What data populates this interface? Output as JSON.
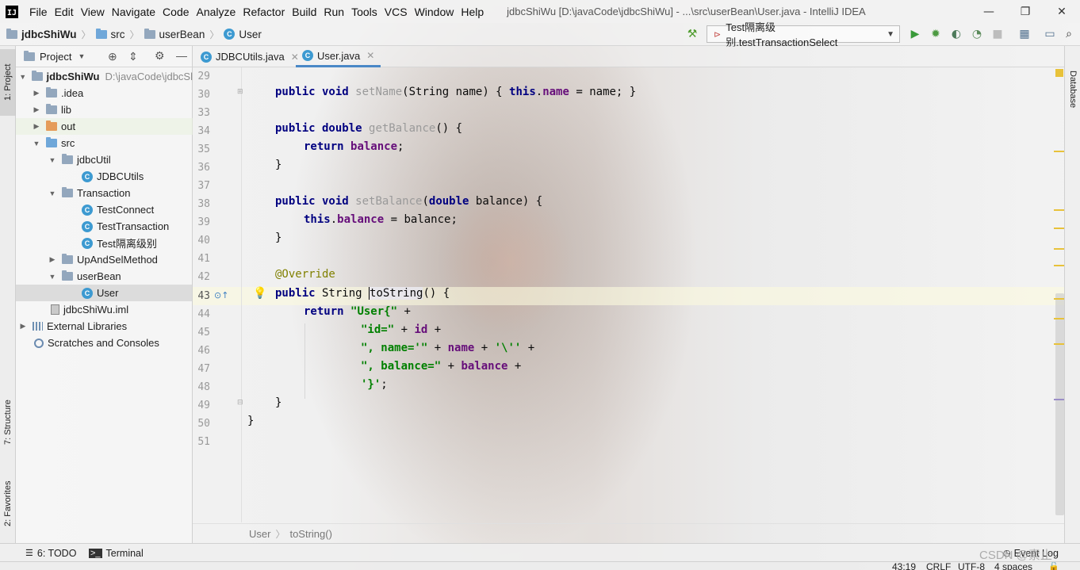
{
  "titlebar": {
    "menu": [
      "File",
      "Edit",
      "View",
      "Navigate",
      "Code",
      "Analyze",
      "Refactor",
      "Build",
      "Run",
      "Tools",
      "VCS",
      "Window",
      "Help"
    ],
    "window_title": "jdbcShiWu [D:\\javaCode\\jdbcShiWu] - ...\\src\\userBean\\User.java - IntelliJ IDEA",
    "minimize": "—",
    "restore": "❐",
    "close": "✕"
  },
  "navbar": {
    "crumbs": [
      "jdbcShiWu",
      "src",
      "userBean",
      "User"
    ],
    "run_config": "Test隔离级别.testTransactionSelect"
  },
  "left_strip": {
    "project_tab": "1: Project",
    "structure_tab": "7: Structure",
    "favorites_tab": "2: Favorites"
  },
  "right_strip": {
    "database_tab": "Database"
  },
  "project_panel": {
    "title": "Project",
    "tree": [
      {
        "label": "jdbcShiWu",
        "extra": "D:\\javaCode\\jdbcSl"
      },
      {
        "label": ".idea"
      },
      {
        "label": "lib"
      },
      {
        "label": "out"
      },
      {
        "label": "src"
      },
      {
        "label": "jdbcUtil"
      },
      {
        "label": "JDBCUtils"
      },
      {
        "label": "Transaction"
      },
      {
        "label": "TestConnect"
      },
      {
        "label": "TestTransaction"
      },
      {
        "label": "Test隔离级别"
      },
      {
        "label": "UpAndSelMethod"
      },
      {
        "label": "userBean"
      },
      {
        "label": "User"
      },
      {
        "label": "jdbcShiWu.iml"
      },
      {
        "label": "External Libraries"
      },
      {
        "label": "Scratches and Consoles"
      }
    ]
  },
  "editor": {
    "tabs": [
      "JDBCUtils.java",
      "User.java"
    ],
    "line_numbers": [
      "29",
      "30",
      "33",
      "34",
      "35",
      "36",
      "37",
      "38",
      "39",
      "40",
      "41",
      "42",
      "43",
      "44",
      "45",
      "46",
      "47",
      "48",
      "49",
      "50",
      "51"
    ],
    "code": {
      "l30_kw": "public void",
      "l30_name": "setName",
      "l30_params": "(String name) {",
      "l30_this": "this",
      "l30_field": "name",
      "l30_rest": " = name; }",
      "l34_kw": "public double",
      "l34_name": "getBalance",
      "l34_rest": "() {",
      "l35_kw": "return",
      "l35_field": "balance",
      "l35_rest": ";",
      "l36": "}",
      "l38_kw": "public void",
      "l38_name": "setBalance",
      "l38_open": "(",
      "l38_kw2": "double",
      "l38_rest": " balance) {",
      "l39_this": "this",
      "l39_field": "balance",
      "l39_rest": " = balance;",
      "l40": "}",
      "l42_ann": "@Override",
      "l43_kw": "public",
      "l43_type": " String ",
      "l43_name": "toString",
      "l43_rest": "() {",
      "l44_kw": "return",
      "l44_str": "\"User{\"",
      "l44_rest": " +",
      "l45_str": "\"id=\"",
      "l45_mid": " + ",
      "l45_field": "id",
      "l45_rest": " +",
      "l46_str": "\", name='\"",
      "l46_mid": " + ",
      "l46_field": "name",
      "l46_mid2": " + ",
      "l46_char": "'\\''",
      "l46_rest": " +",
      "l47_str": "\", balance=\"",
      "l47_mid": " + ",
      "l47_field": "balance",
      "l47_rest": " +",
      "l48_char": "'}'",
      "l48_rest": ";",
      "l49": "}",
      "l50": "}"
    },
    "breadcrumb": [
      "User",
      "toString()"
    ]
  },
  "bottom": {
    "todo": "6: TODO",
    "terminal": "Terminal",
    "event_log": "Event Log"
  },
  "status": {
    "position": "43:19",
    "line_sep": "CRLF",
    "encoding": "UTF-8",
    "indent": "4 spaces"
  },
  "watermark": "CSDN @素止"
}
